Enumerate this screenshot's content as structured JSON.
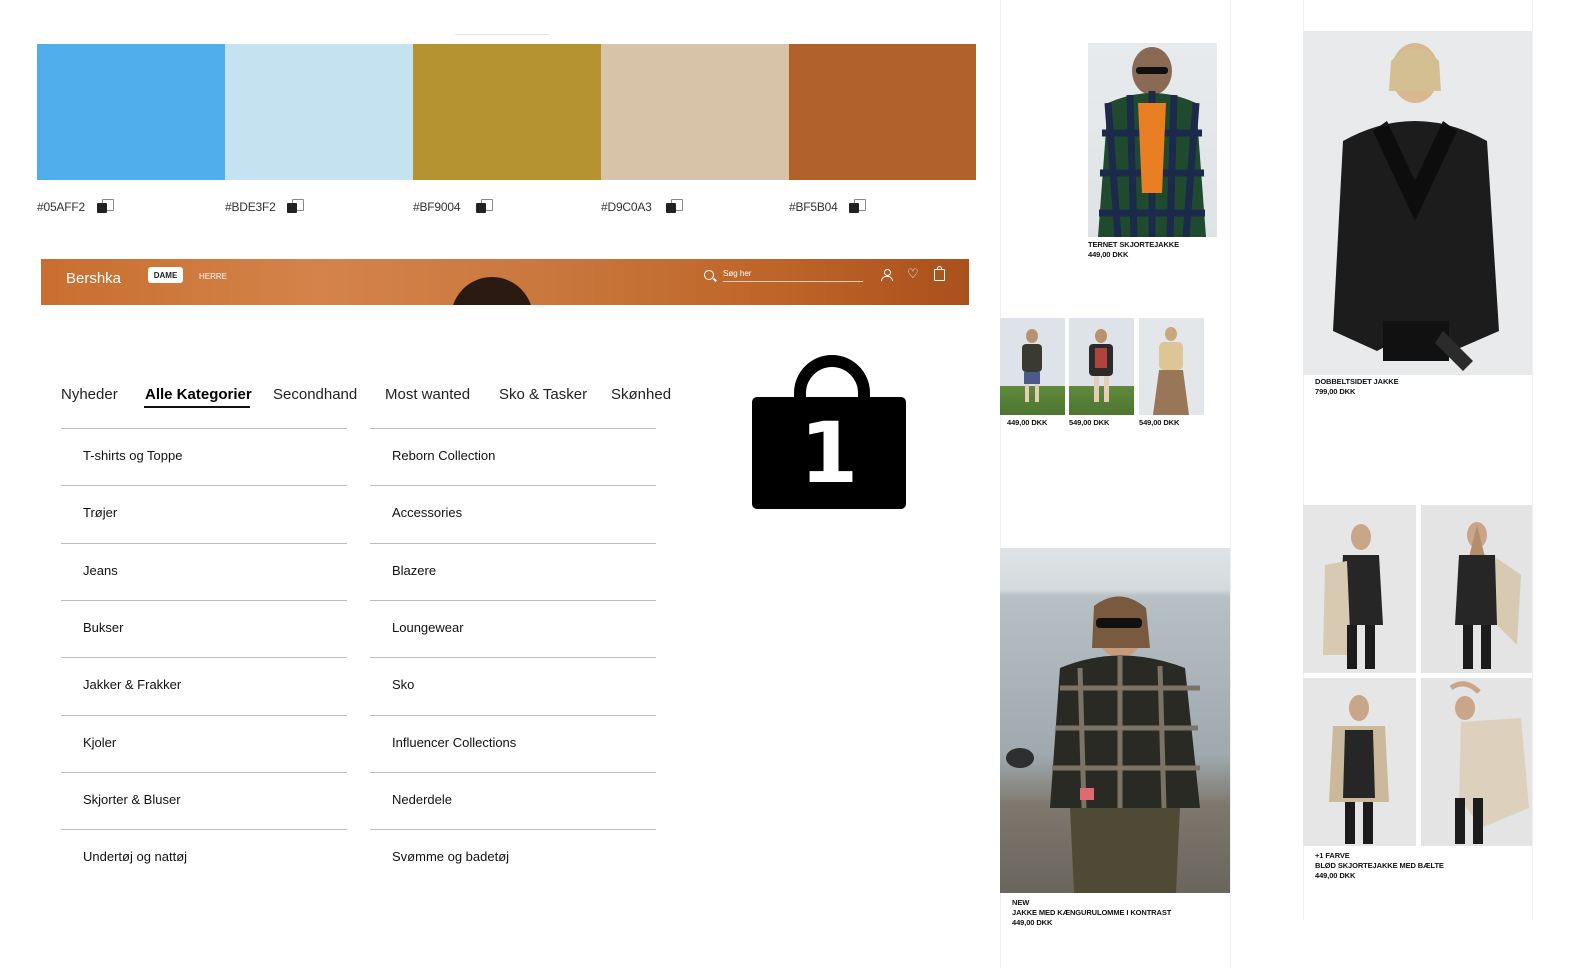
{
  "palette": {
    "colors": [
      {
        "hex_label": "#05AFF2",
        "color": "#4FAEEB"
      },
      {
        "hex_label": "#BDE3F2",
        "color": "#C4E2F0"
      },
      {
        "hex_label": "#BF9004",
        "color": "#B69331"
      },
      {
        "hex_label": "#D9C0A3",
        "color": "#D6C3A8"
      },
      {
        "hex_label": "#BF5B04",
        "color": "#B06129"
      }
    ]
  },
  "bershka_header": {
    "logo": "Bershka",
    "tab_active": "DAME",
    "tab_other": "HERRE",
    "search_placeholder": "Søg her",
    "icons": [
      "search-icon",
      "user-icon",
      "heart-icon",
      "bag-icon"
    ]
  },
  "nav_tabs": [
    {
      "label": "Nyheder",
      "active": false
    },
    {
      "label": "Alle Kategorier",
      "active": true
    },
    {
      "label": "Secondhand",
      "active": false
    },
    {
      "label": "Most wanted",
      "active": false
    },
    {
      "label": "Sko & Tasker",
      "active": false
    },
    {
      "label": "Skønhed",
      "active": false
    }
  ],
  "categories": {
    "left": [
      "T-shirts og Toppe",
      "Trøjer",
      "Jeans",
      "Bukser",
      "Jakker & Frakker",
      "Kjoler",
      "Skjorter & Bluser",
      "Undertøj og nattøj"
    ],
    "right": [
      "Reborn Collection",
      "Accessories",
      "Blazere",
      "Loungewear",
      "Sko",
      "Influencer Collections",
      "Nederdele",
      "Svømme og badetøj"
    ]
  },
  "bag_icon": {
    "count": "1",
    "icon": "shopping-bag-icon"
  },
  "products": {
    "plaid_jacket": {
      "name": "TERNET SKJORTEJAKKE",
      "price": "449,00 DKK"
    },
    "thumb_prices": [
      "449,00 DKK",
      "549,00 DKK",
      "549,00 DKK"
    ],
    "reversible_jacket": {
      "name": "DOBBELTSIDET JAKKE",
      "price": "799,00 DKK"
    },
    "kangaroo_jacket": {
      "badge": "NEW",
      "name": "JAKKE MED KÆNGURULOMME I KONTRAST",
      "price": "449,00 DKK"
    },
    "soft_jacket": {
      "badge": "+1 FARVE",
      "name": "BLØD SKJORTEJAKKE MED BÆLTE",
      "price": "449,00 DKK"
    }
  }
}
